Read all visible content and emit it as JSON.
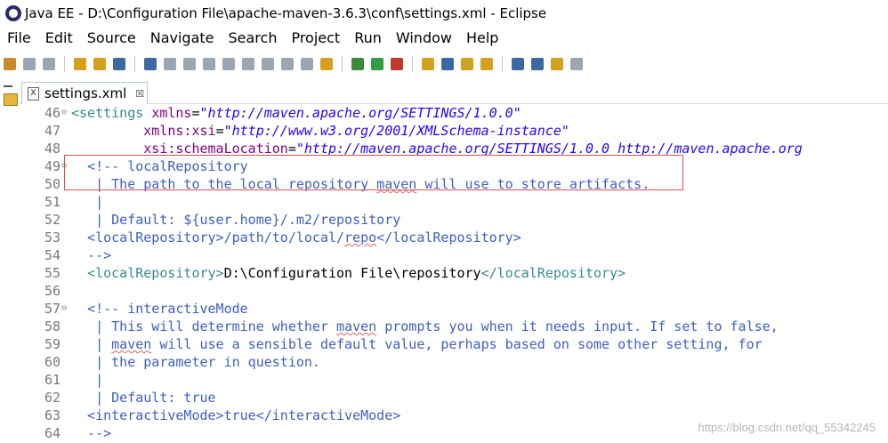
{
  "window": {
    "title": "Java EE - D:\\Configuration File\\apache-maven-3.6.3\\conf\\settings.xml - Eclipse"
  },
  "menu": [
    "File",
    "Edit",
    "Source",
    "Navigate",
    "Search",
    "Project",
    "Run",
    "Window",
    "Help"
  ],
  "tab": {
    "label": "settings.xml",
    "close": "☒",
    "icon_text": "X"
  },
  "lines": [
    {
      "num": "46",
      "fold": "⊖",
      "parts": [
        [
          "tag",
          "<settings "
        ],
        [
          "attr",
          "xmlns"
        ],
        [
          "txt",
          "="
        ],
        [
          "val",
          "\"http://maven.apache.org/SETTINGS/1.0.0\""
        ]
      ]
    },
    {
      "num": "47",
      "fold": "",
      "parts": [
        [
          "txt",
          "         "
        ],
        [
          "attr",
          "xmlns:xsi"
        ],
        [
          "txt",
          "="
        ],
        [
          "val",
          "\"http://www.w3.org/2001/XMLSchema-instance\""
        ]
      ]
    },
    {
      "num": "48",
      "fold": "",
      "parts": [
        [
          "txt",
          "         "
        ],
        [
          "attr",
          "xsi:schemaLocation"
        ],
        [
          "txt",
          "="
        ],
        [
          "val",
          "\"http://maven.apache.org/SETTINGS/1.0.0 http://maven.apache.org"
        ]
      ]
    },
    {
      "num": "49",
      "fold": "⊖",
      "parts": [
        [
          "txt",
          "  "
        ],
        [
          "cmt",
          "<!-- localRepository"
        ]
      ]
    },
    {
      "num": "50",
      "fold": "",
      "parts": [
        [
          "cmt",
          "   | The path to the local repository "
        ],
        [
          "cmt squig",
          "maven"
        ],
        [
          "cmt",
          " will use to store artifacts."
        ]
      ]
    },
    {
      "num": "51",
      "fold": "",
      "parts": [
        [
          "cmt",
          "   |"
        ]
      ]
    },
    {
      "num": "52",
      "fold": "",
      "parts": [
        [
          "cmt",
          "   | Default: ${user.home}/.m2/repository"
        ]
      ]
    },
    {
      "num": "53",
      "fold": "",
      "parts": [
        [
          "cmt",
          "  <localRepository>/path/to/local/"
        ],
        [
          "cmt squig",
          "repo"
        ],
        [
          "cmt",
          "</localRepository>"
        ]
      ]
    },
    {
      "num": "54",
      "fold": "",
      "parts": [
        [
          "cmt",
          "  -->"
        ]
      ]
    },
    {
      "num": "55",
      "fold": "",
      "parts": [
        [
          "txt",
          "  "
        ],
        [
          "tag",
          "<localRepository>"
        ],
        [
          "txt",
          "D:\\Configuration File\\repository"
        ],
        [
          "tag",
          "</localRepository>"
        ]
      ]
    },
    {
      "num": "56",
      "fold": "",
      "parts": []
    },
    {
      "num": "57",
      "fold": "⊖",
      "parts": [
        [
          "txt",
          "  "
        ],
        [
          "cmt",
          "<!-- interactiveMode"
        ]
      ]
    },
    {
      "num": "58",
      "fold": "",
      "parts": [
        [
          "cmt",
          "   | This will determine whether "
        ],
        [
          "cmt squig",
          "maven"
        ],
        [
          "cmt",
          " prompts you when it needs input. If set to false,"
        ]
      ]
    },
    {
      "num": "59",
      "fold": "",
      "parts": [
        [
          "cmt",
          "   | "
        ],
        [
          "cmt squig",
          "maven"
        ],
        [
          "cmt",
          " will use a sensible default value, perhaps based on some other setting, for"
        ]
      ]
    },
    {
      "num": "60",
      "fold": "",
      "parts": [
        [
          "cmt",
          "   | the parameter in question."
        ]
      ]
    },
    {
      "num": "61",
      "fold": "",
      "parts": [
        [
          "cmt",
          "   |"
        ]
      ]
    },
    {
      "num": "62",
      "fold": "",
      "parts": [
        [
          "cmt",
          "   | Default: true"
        ]
      ]
    },
    {
      "num": "63",
      "fold": "",
      "parts": [
        [
          "cmt",
          "  <interactiveMode>true</interactiveMode>"
        ]
      ]
    },
    {
      "num": "64",
      "fold": "",
      "parts": [
        [
          "cmt",
          "  -->"
        ]
      ]
    }
  ],
  "watermark": "https://blog.csdn.net/qq_55342245",
  "toolbar_icons": [
    {
      "name": "new-wizard-icon",
      "color": "#c98a2b"
    },
    {
      "name": "save-icon",
      "color": "#9aa6b2"
    },
    {
      "name": "save-all-icon",
      "color": "#9aa6b2"
    },
    {
      "name": "open-type-icon",
      "color": "#d4a020"
    },
    {
      "name": "open-resource-icon",
      "color": "#d4a020"
    },
    {
      "name": "console-icon",
      "color": "#3b6aa0"
    },
    {
      "name": "skip-breakpoints-icon",
      "color": "#3b6aa0"
    },
    {
      "name": "resume-icon",
      "color": "#9aa6b2"
    },
    {
      "name": "suspend-icon",
      "color": "#9aa6b2"
    },
    {
      "name": "terminate-icon",
      "color": "#9aa6b2"
    },
    {
      "name": "disconnect-icon",
      "color": "#9aa6b2"
    },
    {
      "name": "step-into-icon",
      "color": "#9aa6b2"
    },
    {
      "name": "step-over-icon",
      "color": "#9aa6b2"
    },
    {
      "name": "step-return-icon",
      "color": "#9aa6b2"
    },
    {
      "name": "drop-to-frame-icon",
      "color": "#9aa6b2"
    },
    {
      "name": "use-step-filters-icon",
      "color": "#d4a020"
    },
    {
      "name": "debug-icon",
      "color": "#3a8a3a"
    },
    {
      "name": "run-icon",
      "color": "#2f9e44"
    },
    {
      "name": "external-tools-icon",
      "color": "#c0392b"
    },
    {
      "name": "new-java-project-icon",
      "color": "#d4a020"
    },
    {
      "name": "new-class-icon",
      "color": "#3b6aa0"
    },
    {
      "name": "open-task-icon",
      "color": "#d4a020"
    },
    {
      "name": "search-icon",
      "color": "#d4a020"
    },
    {
      "name": "browser-icon",
      "color": "#3b6aa0"
    },
    {
      "name": "next-annotation-icon",
      "color": "#3b6aa0"
    },
    {
      "name": "back-icon",
      "color": "#d4a020"
    },
    {
      "name": "forward-icon",
      "color": "#9aa6b2"
    }
  ]
}
